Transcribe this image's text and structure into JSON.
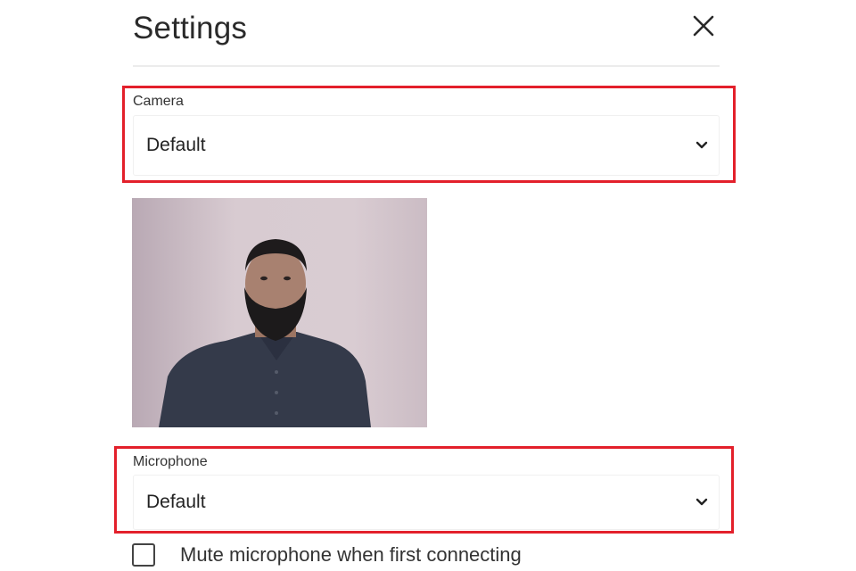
{
  "dialog": {
    "title": "Settings",
    "close_icon": "close-icon"
  },
  "camera": {
    "label": "Camera",
    "selected": "Default",
    "icon": "chevron-down-icon"
  },
  "preview": {
    "description": "camera-preview"
  },
  "microphone": {
    "label": "Microphone",
    "selected": "Default",
    "icon": "chevron-down-icon"
  },
  "mute_option": {
    "label": "Mute microphone when first connecting",
    "checked": false
  },
  "colors": {
    "highlight": "#e3202b",
    "divider": "#ececec",
    "text": "#222222"
  }
}
